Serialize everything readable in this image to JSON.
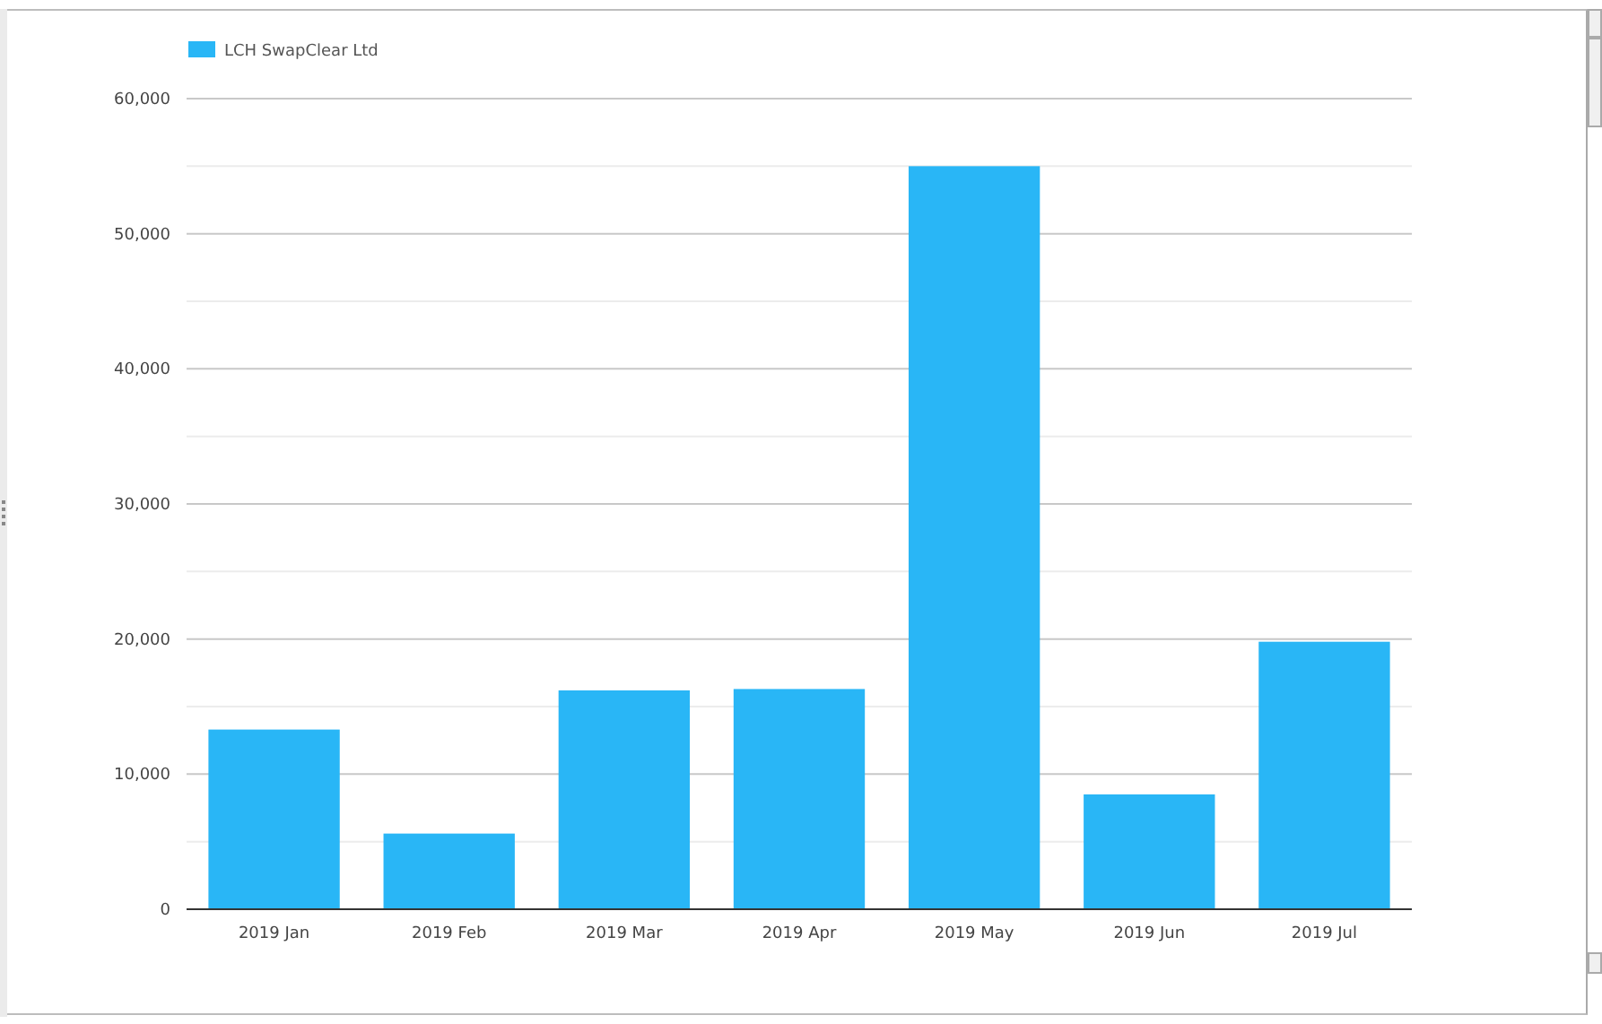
{
  "chart_data": {
    "type": "bar",
    "series": [
      {
        "name": "LCH SwapClear Ltd",
        "color": "#29b6f6",
        "values": [
          13300,
          5600,
          16200,
          16300,
          55000,
          8500,
          19800
        ]
      }
    ],
    "categories": [
      "2019 Jan",
      "2019 Feb",
      "2019 Mar",
      "2019 Apr",
      "2019 May",
      "2019 Jun",
      "2019 Jul"
    ],
    "ylim": [
      0,
      60000
    ],
    "grid": true,
    "yticks": [
      {
        "value": 0,
        "label": "0"
      },
      {
        "value": 10000,
        "label": "10,000"
      },
      {
        "value": 20000,
        "label": "20,000"
      },
      {
        "value": 30000,
        "label": "30,000"
      },
      {
        "value": 40000,
        "label": "40,000"
      },
      {
        "value": 50000,
        "label": "50,000"
      },
      {
        "value": 60000,
        "label": "60,000"
      }
    ]
  }
}
